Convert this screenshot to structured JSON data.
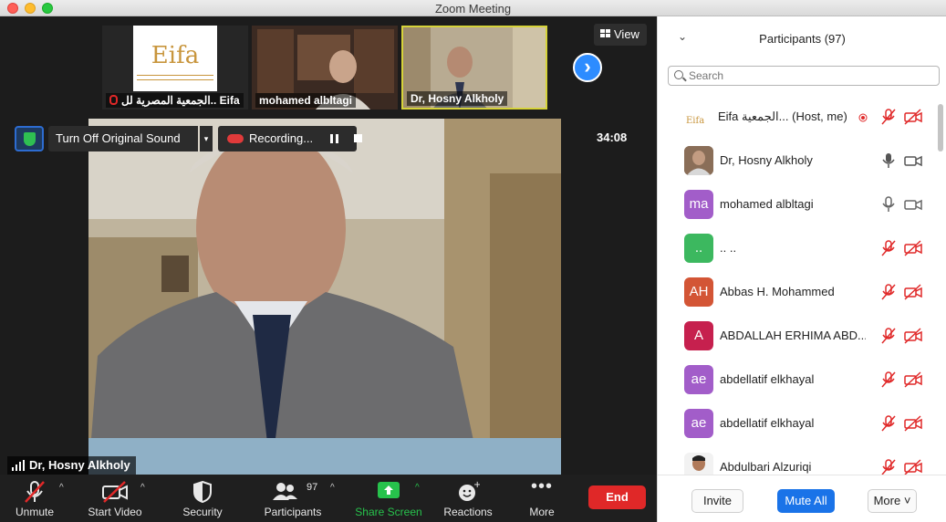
{
  "window": {
    "title": "Zoom Meeting"
  },
  "thumbnails": [
    {
      "name": "الجمعية المصرية لل.. Eifa",
      "logo_text": "Eifa",
      "muted": true
    },
    {
      "name": "mohamed albltagi"
    },
    {
      "name": "Dr, Hosny Alkholy",
      "active": true
    }
  ],
  "view_button": {
    "label": "View"
  },
  "meeting": {
    "original_sound_label": "Turn Off Original Sound",
    "recording_label": "Recording...",
    "timer": "34:08",
    "active_speaker": "Dr, Hosny Alkholy"
  },
  "toolbar": {
    "unmute": "Unmute",
    "start_video": "Start Video",
    "security": "Security",
    "participants": "Participants",
    "participants_count": "97",
    "share_screen": "Share Screen",
    "reactions": "Reactions",
    "more": "More",
    "end": "End"
  },
  "panel": {
    "title": "Participants (97)",
    "search_placeholder": "Search",
    "participants": [
      {
        "name": "Eifa الجمعية... (Host, me)",
        "avatar": "logo",
        "mic": "muted",
        "video": "off"
      },
      {
        "name": "Dr, Hosny Alkholy",
        "avatar": "photo",
        "mic": "on",
        "video": "on"
      },
      {
        "name": "mohamed albltagi",
        "initials": "ma",
        "color": "#a25dc9",
        "mic": "on",
        "video": "on"
      },
      {
        "name": ".. ..",
        "initials": "..",
        "color": "#3cb85f",
        "mic": "muted",
        "video": "off"
      },
      {
        "name": "Abbas H. Mohammed",
        "initials": "AH",
        "color": "#d35535",
        "mic": "muted",
        "video": "off"
      },
      {
        "name": "ABDALLAH ERHIMA ABD...",
        "initials": "A",
        "color": "#c6204e",
        "mic": "muted",
        "video": "off"
      },
      {
        "name": "abdellatif elkhayal",
        "initials": "ae",
        "color": "#a25dc9",
        "mic": "muted",
        "video": "off"
      },
      {
        "name": "abdellatif elkhayal",
        "initials": "ae",
        "color": "#a25dc9",
        "mic": "muted",
        "video": "off"
      },
      {
        "name": "Abdulbari Alzuriqi",
        "avatar": "photo",
        "mic": "muted",
        "video": "off"
      }
    ],
    "buttons": {
      "invite": "Invite",
      "mute_all": "Mute All",
      "more": "More"
    }
  },
  "colors": {
    "accent": "#2d8cff",
    "end": "#e02828",
    "muted": "#e02828",
    "share": "#27c24c"
  }
}
